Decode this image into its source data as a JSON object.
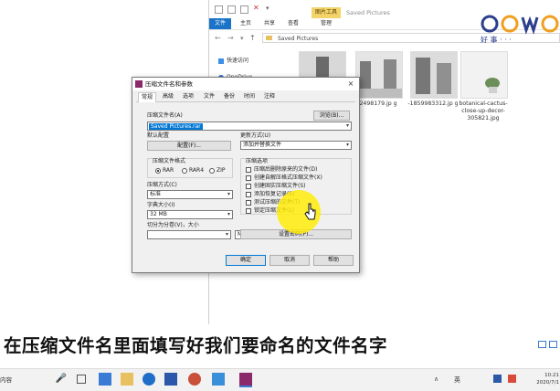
{
  "explorer": {
    "title": "Saved Pictures",
    "picture_tools": "图片工具",
    "ribbon_tabs": [
      "文件",
      "主页",
      "共享",
      "查看",
      "管理"
    ],
    "address": "Saved Pictures",
    "nav": [
      "快速访问",
      "OneDrive"
    ],
    "files": [
      {
        "name": "2498179.jp\ng"
      },
      {
        "name": "-1859983312.jp\ng"
      },
      {
        "name": "botanical-cactus-close-up-decor-305821.jpg"
      }
    ]
  },
  "logo": {
    "text": "好  事  ·  ·  ·"
  },
  "dialog": {
    "title": "压缩文件名和参数",
    "close": "×",
    "tabs": [
      "常规",
      "高级",
      "选项",
      "文件",
      "备份",
      "时间",
      "注释"
    ],
    "archive_name_label": "压缩文件名(A)",
    "browse_button": "浏览(B)...",
    "archive_name_value": "Saved Pictures.rar",
    "default_config_label": "默认配置",
    "config_button": "配置(F)...",
    "update_mode_label": "更新方式(U)",
    "update_mode_value": "添加并替换文件",
    "format_label": "压缩文件格式",
    "formats": [
      "RAR",
      "RAR4",
      "ZIP"
    ],
    "method_label": "压缩方式(C)",
    "method_value": "标准",
    "dict_label": "字典大小(I)",
    "dict_value": "32 MB",
    "split_label": "切分为分卷(V)，大小",
    "split_unit": "MB",
    "options_label": "压缩选项",
    "options": [
      "压缩后删除原来的文件(D)",
      "创建自解压格式压缩文件(X)",
      "创建固实压缩文件(S)",
      "添加恢复记录(E)",
      "测试压缩的文件(T)",
      "锁定压缩文件(L)"
    ],
    "password_button": "设置密码(P)...",
    "ok_button": "确定",
    "cancel_button": "取消",
    "help_button": "帮助"
  },
  "subtitle": "在压缩文件名里面填写好我们要命名的文件名字",
  "taskbar": {
    "search_text": "内容",
    "ime": "英",
    "time": "10:21",
    "date": "2020/7/1"
  },
  "colors": {
    "accent": "#1a73c8",
    "highlight": "#ffec00",
    "tools": "#f3d36a"
  }
}
